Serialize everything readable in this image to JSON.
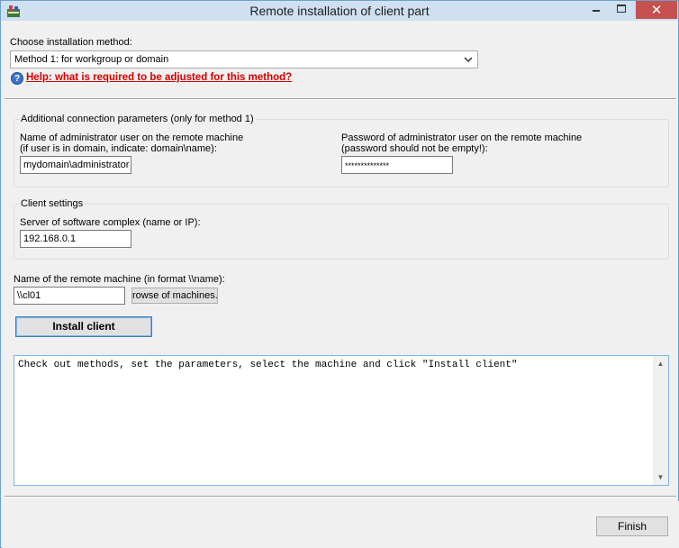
{
  "window": {
    "title": "Remote installation of client part",
    "close_glyph": "✕"
  },
  "method": {
    "label": "Choose installation method:",
    "selected": "Method 1: for workgroup or domain",
    "help_icon_glyph": "?",
    "help_link": "Help: what is required to be adjusted for this method?"
  },
  "connection": {
    "group_title": "Additional connection parameters (only for method 1)",
    "admin_label_line1": "Name of administrator user on the remote machine",
    "admin_label_line2": "(if user is in domain, indicate: domain\\name):",
    "admin_value": "mydomain\\administrator",
    "password_label_line1": "Password of administrator user on the remote machine",
    "password_label_line2": "(password should not be empty!):",
    "password_value": "**************"
  },
  "client": {
    "group_title": "Client settings",
    "server_label": "Server of software complex (name or IP):",
    "server_value": "192.168.0.1"
  },
  "remote": {
    "label": "Name of the remote machine (in format \\\\name):",
    "value": "\\\\cl01",
    "browse_label": "rowse of machines."
  },
  "actions": {
    "install_label": "Install client",
    "finish_label": "Finish"
  },
  "log": {
    "text": "Check out methods, set the parameters, select the machine and click \"Install client\""
  },
  "icons": {
    "app": "app-icon",
    "dropdown": "chevron-down-icon",
    "help": "help-icon",
    "scroll_up": "scroll-up-icon",
    "scroll_down": "scroll-down-icon"
  },
  "colors": {
    "titlebar": "#cfe0f1",
    "close_button": "#c75050",
    "help_link": "#d00000",
    "focus_border": "#7eb4ea"
  }
}
